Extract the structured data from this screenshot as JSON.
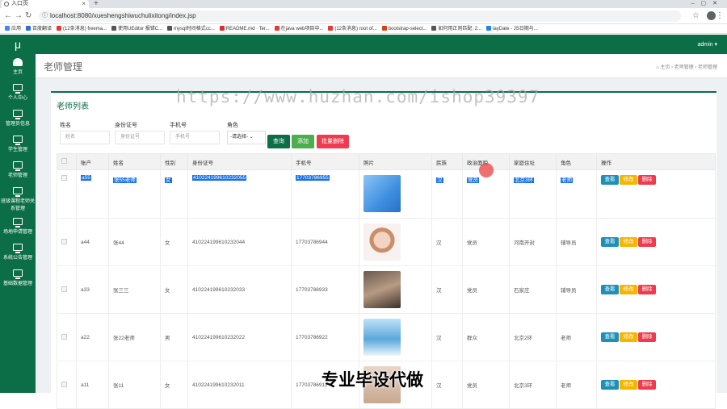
{
  "browser": {
    "tab_title": "入口页",
    "url": "localhost:8080/xueshengshiwuchulixitong/index.jsp",
    "bookmarks": [
      {
        "label": "应用",
        "color": "#4285f4"
      },
      {
        "label": "百度翻译",
        "color": "#2f6fd6"
      },
      {
        "label": "(12条消息) freema...",
        "color": "#e53935"
      },
      {
        "label": "使用UEditor 报错C...",
        "color": "#555555"
      },
      {
        "label": "mysql时间格式cc...",
        "color": "#555555"
      },
      {
        "label": "README.md · Ter...",
        "color": "#d32f2f"
      },
      {
        "label": "在java web项目中...",
        "color": "#e53935"
      },
      {
        "label": "(12条消息) root of...",
        "color": "#e53935"
      },
      {
        "label": "bootstrap-select...",
        "color": "#d84315"
      },
      {
        "label": "如何用正则匹配: 2...",
        "color": "#555555"
      },
      {
        "label": "layDate - JS日期与...",
        "color": "#1e88e5"
      }
    ]
  },
  "sidebar": {
    "logo": "μ",
    "items": [
      {
        "label": "主页",
        "icon": "dashboard-icon"
      },
      {
        "label": "个人中心",
        "icon": "monitor-icon"
      },
      {
        "label": "管理员信息",
        "icon": "monitor-icon"
      },
      {
        "label": "学生管理",
        "icon": "monitor-icon"
      },
      {
        "label": "老师管理",
        "icon": "monitor-icon"
      },
      {
        "label": "班级课程老师关系管理",
        "icon": "monitor-icon"
      },
      {
        "label": "场地申请管理",
        "icon": "monitor-icon"
      },
      {
        "label": "系统公告管理",
        "icon": "monitor-icon"
      },
      {
        "label": "基础数据管理",
        "icon": "monitor-icon"
      }
    ]
  },
  "topbar": {
    "user": "admin ▾"
  },
  "page": {
    "title": "老师管理",
    "breadcrumb": "⌂ 主页 › 老师管理 › 老师管理",
    "list_title": "老师列表"
  },
  "filters": {
    "name_label": "姓名",
    "name_placeholder": "姓名",
    "idcard_label": "身份证号",
    "idcard_placeholder": "身份证号",
    "phone_label": "手机号",
    "phone_placeholder": "手机号",
    "role_label": "角色",
    "role_value": "-请选择-"
  },
  "buttons": {
    "search": "查询",
    "add": "添加",
    "batch_delete": "批量删除"
  },
  "colors": {
    "primary": "#0b6e47",
    "search": "#0b6e47",
    "add": "#4cae4c",
    "delete": "#ef3b4f",
    "view": "#1e90b8",
    "edit": "#f7b500"
  },
  "table": {
    "headers": [
      "",
      "账户",
      "姓名",
      "性别",
      "身份证号",
      "手机号",
      "照片",
      "民族",
      "政治面貌",
      "家庭住址",
      "角色",
      "操作"
    ],
    "actions": {
      "view": "查看",
      "edit": "修改",
      "delete": "删除"
    },
    "rows": [
      {
        "account": "a55",
        "name": "张55老师",
        "gender": "女",
        "idcard": "410224199610232055",
        "phone": "17703786955",
        "nation": "汉",
        "politics": "党员",
        "address": "北京3环",
        "role": "老师"
      },
      {
        "account": "a44",
        "name": "张44",
        "gender": "女",
        "idcard": "410224199610232044",
        "phone": "17703786944",
        "nation": "汉",
        "politics": "党员",
        "address": "河南开封",
        "role": "辅导员"
      },
      {
        "account": "a33",
        "name": "张三三",
        "gender": "女",
        "idcard": "410224199610232033",
        "phone": "17703786933",
        "nation": "汉",
        "politics": "党员",
        "address": "石家庄",
        "role": "辅导员"
      },
      {
        "account": "a22",
        "name": "张22老师",
        "gender": "男",
        "idcard": "410224199610232022",
        "phone": "17703786922",
        "nation": "汉",
        "politics": "群众",
        "address": "北京2环",
        "role": "老师"
      },
      {
        "account": "a11",
        "name": "张11",
        "gender": "女",
        "idcard": "410224199610232011",
        "phone": "17703786911",
        "nation": "汉",
        "politics": "党员",
        "address": "北京3环",
        "role": "老师"
      }
    ]
  },
  "watermark": "https://www.huzhan.com/ishop39397",
  "overlay_text": "专业毕设代做"
}
